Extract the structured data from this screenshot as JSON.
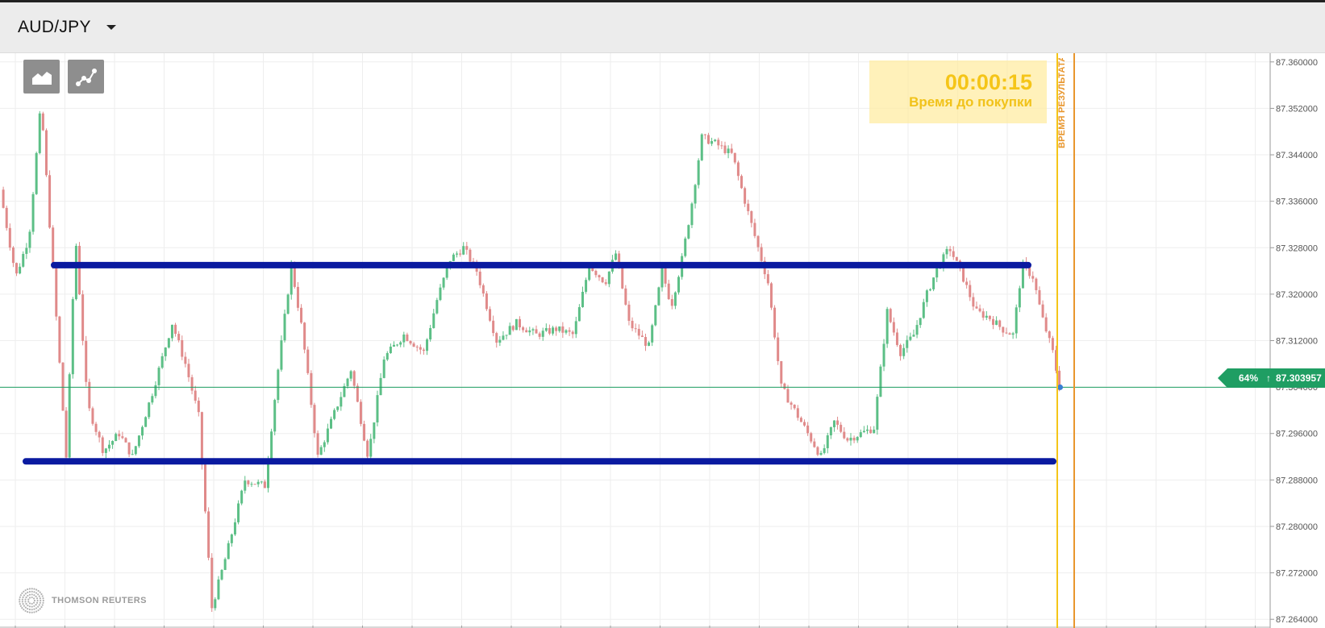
{
  "header": {
    "pair": "AUD/JPY",
    "toolbar": {
      "chart_type_icon": "area-chart-icon",
      "indicators_icon": "indicator-chart-icon"
    }
  },
  "timer": {
    "value": "00:00:15",
    "label": "Время до покупки"
  },
  "result_line_label": "ВРЕМЯ РЕЗУЛЬТАТА",
  "current_price": {
    "percent": "64%",
    "arrow": "↑",
    "value": "87.303957"
  },
  "watermark": "THOMSON REUTERS",
  "colors": {
    "up_candle": "#5cbf86",
    "down_candle": "#e08a8a",
    "drawn_lines": "#0a1aa0",
    "price_line": "#1f9e63",
    "timer_text": "#f5c518",
    "purchase_line": "#f5c518",
    "result_line": "#e8962d"
  },
  "chart_data": {
    "type": "candlestick",
    "title": "",
    "y_axis_labels": [
      "87.360000",
      "87.352000",
      "87.344000",
      "87.336000",
      "87.328000",
      "87.320000",
      "87.312000",
      "87.304000",
      "87.296000",
      "87.288000",
      "87.280000",
      "87.272000",
      "87.264000"
    ],
    "ylim": [
      87.2625,
      87.3615
    ],
    "grid": true,
    "current_price": 87.303957,
    "drawn_horizontal_lines": [
      87.325,
      87.2912
    ],
    "close_path": [
      [
        0.0,
        87.338
      ],
      [
        0.012,
        87.323
      ],
      [
        0.022,
        87.33
      ],
      [
        0.031,
        87.353
      ],
      [
        0.04,
        87.324
      ],
      [
        0.05,
        87.292
      ],
      [
        0.057,
        87.33
      ],
      [
        0.066,
        87.301
      ],
      [
        0.078,
        87.293
      ],
      [
        0.09,
        87.296
      ],
      [
        0.1,
        87.292
      ],
      [
        0.115,
        87.303
      ],
      [
        0.13,
        87.315
      ],
      [
        0.14,
        87.308
      ],
      [
        0.15,
        87.299
      ],
      [
        0.16,
        87.266
      ],
      [
        0.172,
        87.276
      ],
      [
        0.185,
        87.288
      ],
      [
        0.2,
        87.287
      ],
      [
        0.21,
        87.307
      ],
      [
        0.22,
        87.325
      ],
      [
        0.228,
        87.314
      ],
      [
        0.24,
        87.292
      ],
      [
        0.255,
        87.301
      ],
      [
        0.265,
        87.307
      ],
      [
        0.278,
        87.292
      ],
      [
        0.29,
        87.309
      ],
      [
        0.305,
        87.313
      ],
      [
        0.32,
        87.31
      ],
      [
        0.33,
        87.319
      ],
      [
        0.34,
        87.326
      ],
      [
        0.35,
        87.328
      ],
      [
        0.36,
        87.324
      ],
      [
        0.375,
        87.312
      ],
      [
        0.39,
        87.315
      ],
      [
        0.405,
        87.313
      ],
      [
        0.42,
        87.314
      ],
      [
        0.433,
        87.313
      ],
      [
        0.445,
        87.325
      ],
      [
        0.457,
        87.322
      ],
      [
        0.465,
        87.327
      ],
      [
        0.475,
        87.315
      ],
      [
        0.49,
        87.311
      ],
      [
        0.5,
        87.324
      ],
      [
        0.507,
        87.318
      ],
      [
        0.515,
        87.326
      ],
      [
        0.522,
        87.335
      ],
      [
        0.53,
        87.347
      ],
      [
        0.54,
        87.346
      ],
      [
        0.553,
        87.344
      ],
      [
        0.565,
        87.334
      ],
      [
        0.58,
        87.322
      ],
      [
        0.59,
        87.304
      ],
      [
        0.6,
        87.3
      ],
      [
        0.61,
        87.296
      ],
      [
        0.62,
        87.292
      ],
      [
        0.63,
        87.298
      ],
      [
        0.64,
        87.295
      ],
      [
        0.65,
        87.296
      ],
      [
        0.66,
        87.297
      ],
      [
        0.67,
        87.317
      ],
      [
        0.68,
        87.31
      ],
      [
        0.69,
        87.313
      ],
      [
        0.7,
        87.32
      ],
      [
        0.707,
        87.324
      ],
      [
        0.717,
        87.328
      ],
      [
        0.727,
        87.323
      ],
      [
        0.737,
        87.317
      ],
      [
        0.747,
        87.316
      ],
      [
        0.757,
        87.314
      ],
      [
        0.765,
        87.313
      ],
      [
        0.772,
        87.325
      ],
      [
        0.78,
        87.323
      ],
      [
        0.787,
        87.316
      ],
      [
        0.795,
        87.31
      ],
      [
        0.8,
        87.304
      ]
    ]
  }
}
